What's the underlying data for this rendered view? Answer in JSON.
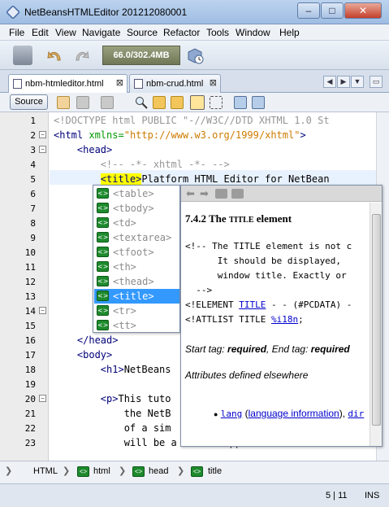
{
  "window": {
    "title": "NetBeansHTMLEditor 201212080001",
    "minimize": "–",
    "maximize": "□",
    "close": "✕"
  },
  "menu": [
    "File",
    "Edit",
    "View",
    "Navigate",
    "Source",
    "Refactor",
    "Tools",
    "Window",
    "Help"
  ],
  "toolbar": {
    "memory": "66.0/302.4MB"
  },
  "tabs": [
    {
      "label": "nbm-htmleditor.html",
      "close": "⊠"
    },
    {
      "label": "nbm-crud.html",
      "close": "⊠"
    }
  ],
  "tab_nav": {
    "left": "◀",
    "right": "▶",
    "list": "▼",
    "restore": "▭"
  },
  "editor_toolbar": {
    "source_label": "Source"
  },
  "line_numbers": [
    "1",
    "2",
    "3",
    "4",
    "5",
    "6",
    "7",
    "8",
    "9",
    "10",
    "11",
    "12",
    "13",
    "14",
    "15",
    "16",
    "17",
    "18",
    "19",
    "20",
    "21",
    "22",
    "23"
  ],
  "code": {
    "l1": "<!DOCTYPE html PUBLIC \"-//W3C//DTD XHTML 1.0 St",
    "l2_tag_open": "<html ",
    "l2_attr": "xmlns=",
    "l2_value": "\"http://www.w3.org/1999/xhtml\"",
    "l2_close": ">",
    "l3": "    <head>",
    "l4": "        <!-- -*- xhtml -*- -->",
    "l5_indent": "        ",
    "l5_tag": "<title>",
    "l5_text": "Platform HTML Editor for NetBean",
    "l15": "    </head>",
    "l17": "    <body>",
    "l18_tag": "        <h1>",
    "l18_text": "NetBeans",
    "l20_tag": "        <p>",
    "l20_text": "This tuto",
    "l21": "            the NetB",
    "l22": "            of a sim",
    "l23": "            will be a mature application becaus"
  },
  "completion": {
    "icon": "<>",
    "items": [
      "<table>",
      "<tbody>",
      "<td>",
      "<textarea>",
      "<tfoot>",
      "<th>",
      "<thead>",
      "<title>",
      "<tr>",
      "<tt>"
    ],
    "selected_index": 7
  },
  "doc": {
    "nav": {
      "back": "⬅",
      "forward": "➡"
    },
    "heading_prefix": "7.4.2 The ",
    "heading_code": "TITLE",
    "heading_suffix": " element",
    "comment1": "<!-- The TITLE element is not c",
    "comment2": "      It should be displayed,",
    "comment3": "      window title. Exactly or",
    "comment4": "  -->",
    "element_prefix": "<!ELEMENT ",
    "element_link": "TITLE",
    "element_suffix": " - - (#PCDATA) -",
    "attlist_prefix": "<!ATTLIST TITLE ",
    "attlist_link": "%i18n",
    "attlist_suffix": ";",
    "start_tag_label": "Start tag: ",
    "start_tag_value": "required",
    "end_tag_label": ", End tag: ",
    "end_tag_value": "required",
    "attributes_label": "Attributes defined elsewhere",
    "bullet_link1": "lang",
    "bullet_open": " (",
    "bullet_link2": "language information",
    "bullet_close": "), ",
    "bullet_link3": "dir"
  },
  "breadcrumb": [
    "HTML",
    "html",
    "head",
    "title"
  ],
  "status": {
    "position": "5 | 11",
    "mode": "INS"
  }
}
